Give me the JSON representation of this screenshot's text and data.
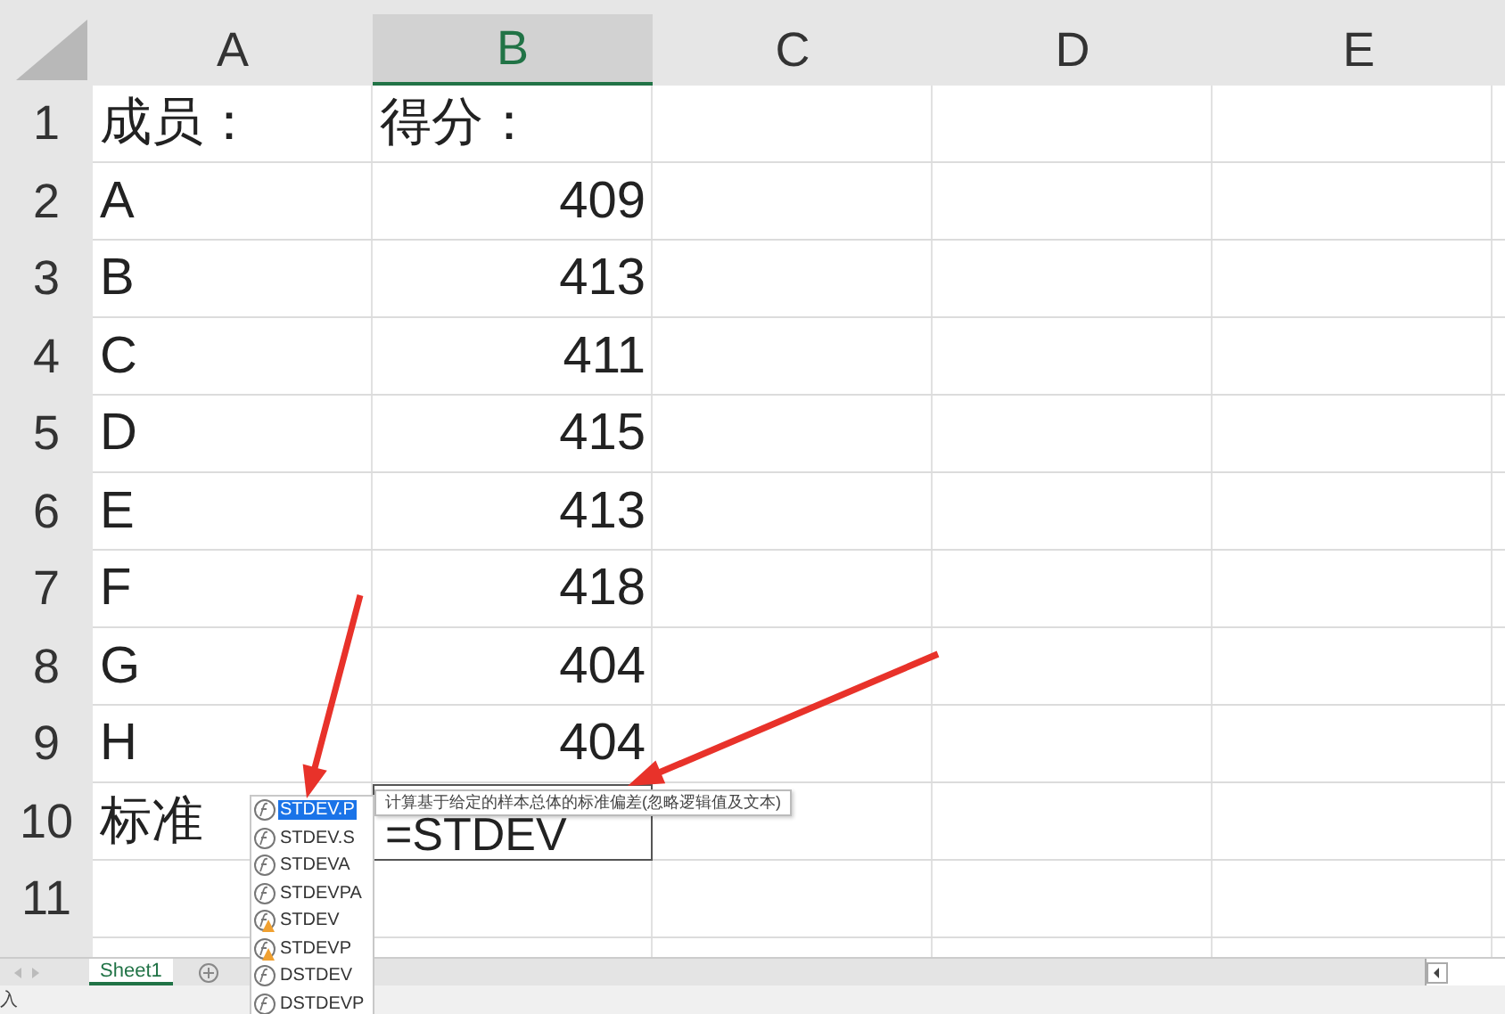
{
  "columns": [
    {
      "label": "A",
      "selected": false
    },
    {
      "label": "B",
      "selected": true
    },
    {
      "label": "C",
      "selected": false
    },
    {
      "label": "D",
      "selected": false
    },
    {
      "label": "E",
      "selected": false
    }
  ],
  "rows": [
    {
      "number": "1",
      "cells": [
        {
          "kind": "text",
          "text": "成员："
        },
        {
          "kind": "text",
          "text": "得分："
        }
      ]
    },
    {
      "number": "2",
      "cells": [
        {
          "kind": "text",
          "text": "A"
        },
        {
          "kind": "number",
          "text": "409"
        }
      ]
    },
    {
      "number": "3",
      "cells": [
        {
          "kind": "text",
          "text": "B"
        },
        {
          "kind": "number",
          "text": "413"
        }
      ]
    },
    {
      "number": "4",
      "cells": [
        {
          "kind": "text",
          "text": "C"
        },
        {
          "kind": "number",
          "text": "411"
        }
      ]
    },
    {
      "number": "5",
      "cells": [
        {
          "kind": "text",
          "text": "D"
        },
        {
          "kind": "number",
          "text": "415"
        }
      ]
    },
    {
      "number": "6",
      "cells": [
        {
          "kind": "text",
          "text": "E"
        },
        {
          "kind": "number",
          "text": "413"
        }
      ]
    },
    {
      "number": "7",
      "cells": [
        {
          "kind": "text",
          "text": "F"
        },
        {
          "kind": "number",
          "text": "418"
        }
      ]
    },
    {
      "number": "8",
      "cells": [
        {
          "kind": "text",
          "text": "G"
        },
        {
          "kind": "number",
          "text": "404"
        }
      ]
    },
    {
      "number": "9",
      "cells": [
        {
          "kind": "text",
          "text": "H"
        },
        {
          "kind": "number",
          "text": "404"
        }
      ]
    },
    {
      "number": "10",
      "cells": [
        {
          "kind": "text",
          "text": "标准"
        },
        {
          "kind": "editing",
          "text": "=STDEV"
        }
      ]
    },
    {
      "number": "11",
      "cells": []
    }
  ],
  "autocomplete": {
    "items": [
      {
        "name": "STDEV.P",
        "kind": "function",
        "selected": true
      },
      {
        "name": "STDEV.S",
        "kind": "function",
        "selected": false
      },
      {
        "name": "STDEVA",
        "kind": "function",
        "selected": false
      },
      {
        "name": "STDEVPA",
        "kind": "function",
        "selected": false
      },
      {
        "name": "STDEV",
        "kind": "legacy",
        "selected": false
      },
      {
        "name": "STDEVP",
        "kind": "legacy",
        "selected": false
      },
      {
        "name": "DSTDEV",
        "kind": "function",
        "selected": false
      },
      {
        "name": "DSTDEVP",
        "kind": "function",
        "selected": false
      }
    ],
    "tooltip": "计算基于给定的样本总体的标准偏差(忽略逻辑值及文本)"
  },
  "sheet_tabs": [
    {
      "label": "Sheet1",
      "selected": true
    }
  ],
  "status_bar": {
    "text": "入"
  }
}
